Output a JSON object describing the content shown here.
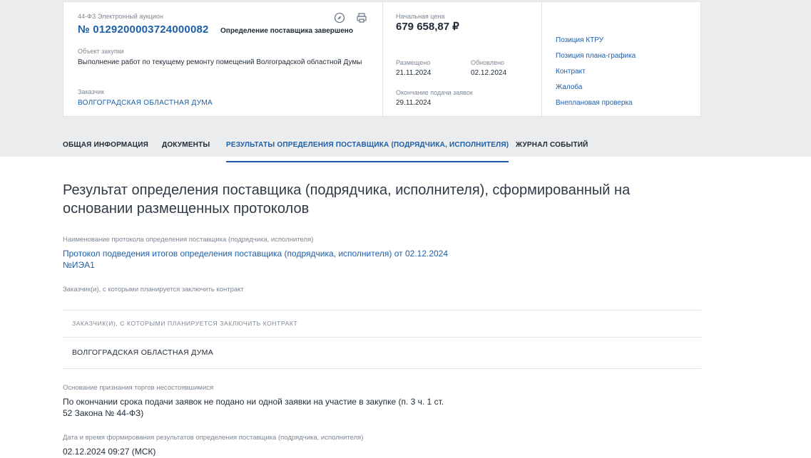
{
  "header": {
    "law_type": "44-ФЗ Электронный аукцион",
    "purchase_number": "№ 0129200003724000082",
    "status": "Определение поставщика завершено",
    "object_label": "Объект закупки",
    "object_value": "Выполнение работ по текущему ремонту помещений Волгоградской областной Думы",
    "customer_label": "Заказчик",
    "customer_value": "ВОЛГОГРАДСКАЯ ОБЛАСТНАЯ ДУМА",
    "price_label": "Начальная цена",
    "price_value": "679 658,87 ₽",
    "posted_label": "Размещено",
    "posted_value": "21.11.2024",
    "updated_label": "Обновлено",
    "updated_value": "02.12.2024",
    "deadline_label": "Окончание подачи заявок",
    "deadline_value": "29.11.2024",
    "icons": [
      "compass-icon",
      "print-icon"
    ]
  },
  "side_links": [
    "Позиция КТРУ",
    "Позиция плана-графика",
    "Контракт",
    "Жалоба",
    "Внеплановая проверка"
  ],
  "tabs": [
    {
      "label": "ОБЩАЯ ИНФОРМАЦИЯ",
      "active": false
    },
    {
      "label": "ДОКУМЕНТЫ",
      "active": false
    },
    {
      "label": "РЕЗУЛЬТАТЫ ОПРЕДЕЛЕНИЯ ПОСТАВЩИКА (ПОДРЯДЧИКА, ИСПОЛНИТЕЛЯ)",
      "active": true
    },
    {
      "label": "ЖУРНАЛ СОБЫТИЙ",
      "active": false
    }
  ],
  "main": {
    "title": "Результат определения поставщика (подрядчика, исполнителя), сформированный на основании размещенных протоколов",
    "protocol_label": "Наименование протокола определения поставщика (подрядчика, исполнителя)",
    "protocol_line1": "Протокол подведения итогов определения поставщика (подрядчика, исполнителя) от 02.12.2024",
    "protocol_line2": "№ИЭА1",
    "customers_label": "Заказчик(и), с которыми планируется заключить контракт",
    "table_header": "ЗАКАЗЧИК(И), С КОТОРЫМИ ПЛАНИРУЕТСЯ ЗАКЛЮЧИТЬ КОНТРАКТ",
    "table_rows": [
      "ВОЛГОГРАДСКАЯ ОБЛАСТНАЯ ДУМА"
    ],
    "reason_label": "Основание признания торгов несостоявшимися",
    "reason_line1": "По окончании срока подачи заявок не подано ни одной заявки на участие в закупке (п. 3 ч. 1 ст.",
    "reason_line2": "52 Закона № 44-ФЗ)",
    "datetime_label": "Дата и время формирования результатов определения поставщика (подрядчика, исполнителя)",
    "datetime_value": "02.12.2024 09:27 (МСК)"
  },
  "colors": {
    "accent": "#1d5ea8",
    "band": "#ebecee",
    "text": "#1f2a37",
    "muted": "#7b8794"
  }
}
